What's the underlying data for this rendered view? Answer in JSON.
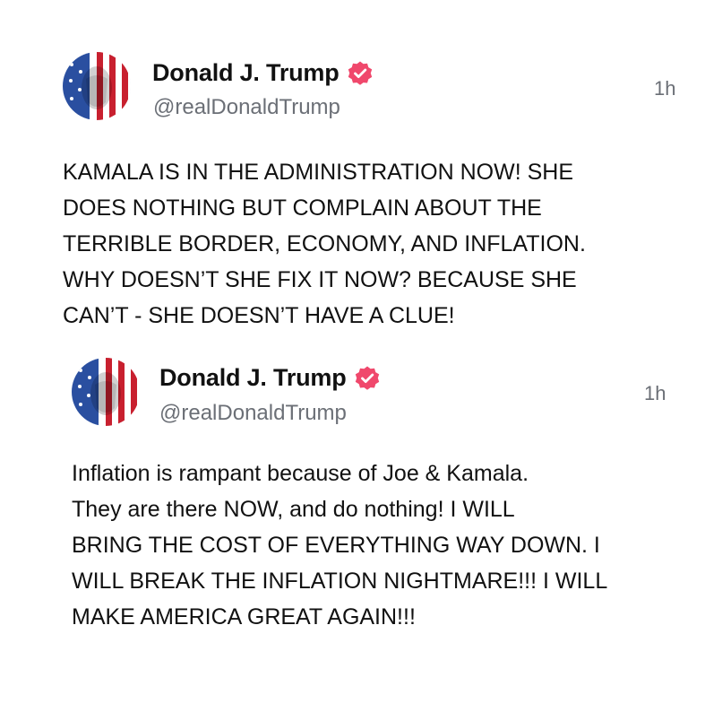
{
  "posts": [
    {
      "author": {
        "display_name": "Donald J. Trump",
        "handle": "@realDonaldTrump",
        "verified": true,
        "avatar_icon": "flag-portrait-avatar"
      },
      "timestamp": "1h",
      "text": "KAMALA IS IN THE ADMINISTRATION NOW! SHE\nDOES NOTHING BUT COMPLAIN ABOUT THE\nTERRIBLE BORDER, ECONOMY, AND INFLATION.\nWHY DOESN’T SHE FIX IT NOW? BECAUSE SHE\nCAN’T - SHE DOESN’T HAVE A CLUE!"
    },
    {
      "author": {
        "display_name": "Donald J. Trump",
        "handle": "@realDonaldTrump",
        "verified": true,
        "avatar_icon": "flag-portrait-avatar"
      },
      "timestamp": "1h",
      "text": "Inflation is rampant because of Joe & Kamala.\nThey are there NOW, and do nothing! I WILL\nBRING THE COST OF EVERYTHING WAY DOWN. I\nWILL BREAK THE INFLATION NIGHTMARE!!! I WILL\nMAKE AMERICA GREAT AGAIN!!!"
    }
  ],
  "colors": {
    "verified_badge": "#f0486c",
    "secondary_text": "#6b6f76",
    "primary_text": "#111111",
    "flag_red": "#c8202f",
    "flag_blue": "#2a4fa0"
  }
}
